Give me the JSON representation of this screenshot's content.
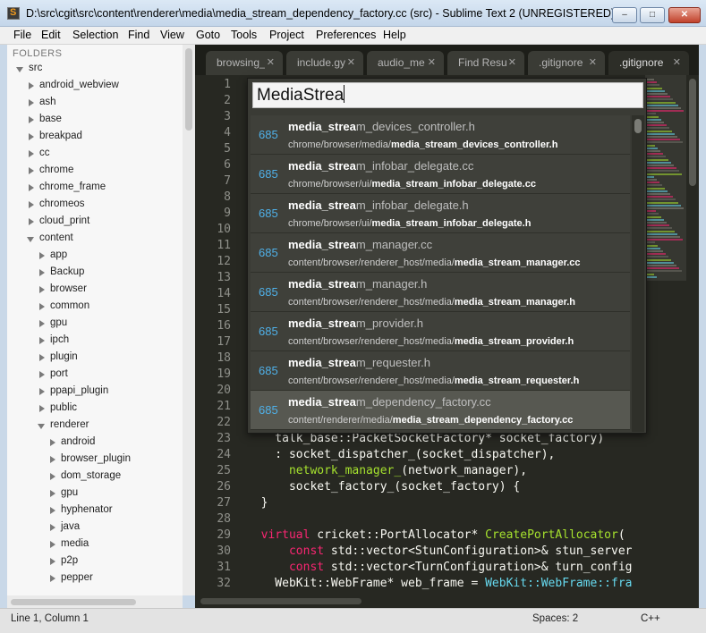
{
  "window": {
    "title": "D:\\src\\cgit\\src\\content\\renderer\\media\\media_stream_dependency_factory.cc (src) - Sublime Text 2 (UNREGISTERED)",
    "min_glyph": "‒",
    "max_glyph": "□",
    "close_glyph": "✕"
  },
  "menu": [
    "File",
    "Edit",
    "Selection",
    "Find",
    "View",
    "Goto",
    "Tools",
    "Project",
    "Preferences",
    "Help"
  ],
  "sidebar": {
    "header": "FOLDERS",
    "tree": [
      {
        "label": "src",
        "state": "open",
        "depth": 0
      },
      {
        "label": "android_webview",
        "state": "closed",
        "depth": 1
      },
      {
        "label": "ash",
        "state": "closed",
        "depth": 1
      },
      {
        "label": "base",
        "state": "closed",
        "depth": 1
      },
      {
        "label": "breakpad",
        "state": "closed",
        "depth": 1
      },
      {
        "label": "cc",
        "state": "closed",
        "depth": 1
      },
      {
        "label": "chrome",
        "state": "closed",
        "depth": 1
      },
      {
        "label": "chrome_frame",
        "state": "closed",
        "depth": 1
      },
      {
        "label": "chromeos",
        "state": "closed",
        "depth": 1
      },
      {
        "label": "cloud_print",
        "state": "closed",
        "depth": 1
      },
      {
        "label": "content",
        "state": "open",
        "depth": 1
      },
      {
        "label": "app",
        "state": "closed",
        "depth": 2
      },
      {
        "label": "Backup",
        "state": "closed",
        "depth": 2
      },
      {
        "label": "browser",
        "state": "closed",
        "depth": 2
      },
      {
        "label": "common",
        "state": "closed",
        "depth": 2
      },
      {
        "label": "gpu",
        "state": "closed",
        "depth": 2
      },
      {
        "label": "ipch",
        "state": "closed",
        "depth": 2
      },
      {
        "label": "plugin",
        "state": "closed",
        "depth": 2
      },
      {
        "label": "port",
        "state": "closed",
        "depth": 2
      },
      {
        "label": "ppapi_plugin",
        "state": "closed",
        "depth": 2
      },
      {
        "label": "public",
        "state": "closed",
        "depth": 2
      },
      {
        "label": "renderer",
        "state": "open",
        "depth": 2
      },
      {
        "label": "android",
        "state": "closed",
        "depth": 3
      },
      {
        "label": "browser_plugin",
        "state": "closed",
        "depth": 3
      },
      {
        "label": "dom_storage",
        "state": "closed",
        "depth": 3
      },
      {
        "label": "gpu",
        "state": "closed",
        "depth": 3
      },
      {
        "label": "hyphenator",
        "state": "closed",
        "depth": 3
      },
      {
        "label": "java",
        "state": "closed",
        "depth": 3
      },
      {
        "label": "media",
        "state": "closed",
        "depth": 3
      },
      {
        "label": "p2p",
        "state": "closed",
        "depth": 3
      },
      {
        "label": "pepper",
        "state": "closed",
        "depth": 3
      }
    ]
  },
  "tabs": [
    {
      "label": "browsing_",
      "close": "✕"
    },
    {
      "label": "include.gy",
      "close": "✕"
    },
    {
      "label": "audio_me",
      "close": "✕"
    },
    {
      "label": "Find Resul",
      "close": "✕"
    },
    {
      "label": ".gitignore",
      "close": "✕"
    },
    {
      "label": ".gitignore",
      "close": "✕"
    }
  ],
  "line_numbers": [
    "1",
    "2",
    "3",
    "4",
    "5",
    "6",
    "7",
    "8",
    "9",
    "10",
    "11",
    "12",
    "13",
    "14",
    "15",
    "16",
    "17",
    "18",
    "19",
    "20",
    "21",
    "22",
    "23",
    "24",
    "25",
    "26",
    "27",
    "28",
    "29",
    "30",
    "31",
    "32"
  ],
  "code_lines": [
    {
      "line": 23,
      "parts": [
        {
          "t": "    talk_base::PacketSocketFactory* socket_factory)",
          "c": ""
        }
      ]
    },
    {
      "line": 24,
      "parts": [
        {
          "t": "    : socket_dispatcher_(socket_dispatcher),",
          "c": ""
        }
      ]
    },
    {
      "line": 25,
      "parts": [
        {
          "t": "      ",
          "c": ""
        },
        {
          "t": "network_manager_",
          "c": "fn"
        },
        {
          "t": "(network_manager),",
          "c": ""
        }
      ]
    },
    {
      "line": 26,
      "parts": [
        {
          "t": "      socket_factory_(socket_factory) {",
          "c": ""
        }
      ]
    },
    {
      "line": 27,
      "parts": [
        {
          "t": "  }",
          "c": ""
        }
      ]
    },
    {
      "line": 28,
      "parts": [
        {
          "t": "",
          "c": ""
        }
      ]
    },
    {
      "line": 29,
      "parts": [
        {
          "t": "  ",
          "c": ""
        },
        {
          "t": "virtual",
          "c": "kw"
        },
        {
          "t": " cricket::PortAllocator* ",
          "c": ""
        },
        {
          "t": "CreatePortAllocator",
          "c": "fn"
        },
        {
          "t": "(",
          "c": ""
        }
      ]
    },
    {
      "line": 30,
      "parts": [
        {
          "t": "      ",
          "c": ""
        },
        {
          "t": "const",
          "c": "kw"
        },
        {
          "t": " std::vector<StunConfiguration>& stun_server",
          "c": ""
        }
      ]
    },
    {
      "line": 31,
      "parts": [
        {
          "t": "      ",
          "c": ""
        },
        {
          "t": "const",
          "c": "kw"
        },
        {
          "t": " std::vector<TurnConfiguration>& turn_config",
          "c": ""
        }
      ]
    },
    {
      "line": 32,
      "parts": [
        {
          "t": "    WebKit::WebFrame* web_frame = ",
          "c": ""
        },
        {
          "t": "WebKit::WebFrame::fra",
          "c": "ty"
        }
      ]
    }
  ],
  "goto": {
    "query": "MediaStrea",
    "results": [
      {
        "score": "685",
        "match": "media_strea",
        "rest": "m_devices_controller.h",
        "path_pre": "chrome/browser/media/",
        "path_bold": "media_stream_devices_controller.h",
        "path_post": ""
      },
      {
        "score": "685",
        "match": "media_strea",
        "rest": "m_infobar_delegate.cc",
        "path_pre": "chrome/browser/ui/",
        "path_bold": "media_stream_infobar_delegate.cc",
        "path_post": ""
      },
      {
        "score": "685",
        "match": "media_strea",
        "rest": "m_infobar_delegate.h",
        "path_pre": "chrome/browser/ui/",
        "path_bold": "media_stream_infobar_delegate.h",
        "path_post": ""
      },
      {
        "score": "685",
        "match": "media_strea",
        "rest": "m_manager.cc",
        "path_pre": "content/browser/renderer_host/media/",
        "path_bold": "media_strea",
        "path_post": "m_manager.cc"
      },
      {
        "score": "685",
        "match": "media_strea",
        "rest": "m_manager.h",
        "path_pre": "content/browser/renderer_host/media/",
        "path_bold": "media_strea",
        "path_post": "m_manager.h"
      },
      {
        "score": "685",
        "match": "media_strea",
        "rest": "m_provider.h",
        "path_pre": "content/browser/renderer_host/media/",
        "path_bold": "media_stream",
        "path_post": "_provider.h"
      },
      {
        "score": "685",
        "match": "media_strea",
        "rest": "m_requester.h",
        "path_pre": "content/browser/renderer_host/media/",
        "path_bold": "media_stream",
        "path_post": "_requester.h"
      },
      {
        "score": "685",
        "match": "media_strea",
        "rest": "m_dependency_factory.cc",
        "path_pre": "content/renderer/media/",
        "path_bold": "media_stream",
        "path_post": "_dependency_factory.cc"
      }
    ],
    "selected_index": 7
  },
  "status": {
    "position": "Line 1, Column 1",
    "indent": "Spaces: 2",
    "syntax": "C++"
  }
}
